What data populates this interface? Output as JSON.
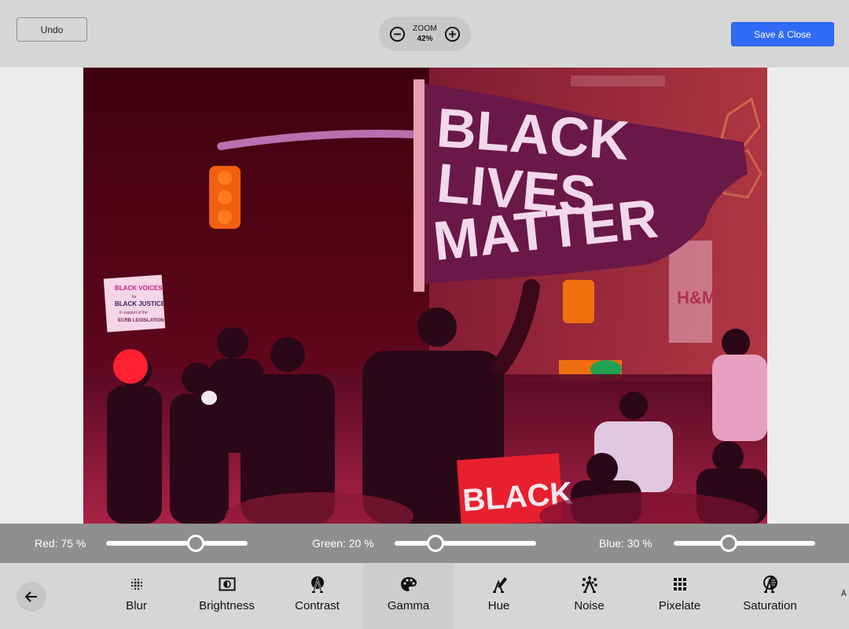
{
  "header": {
    "undo_label": "Undo",
    "zoom": {
      "label": "ZOOM",
      "value": "42%",
      "zoom_out_icon": "minus-circle-icon",
      "zoom_in_icon": "plus-circle-icon"
    },
    "save_label": "Save & Close",
    "save_color": "#2f6bf5"
  },
  "image": {
    "description": "Protest photo with red color filter: man holding 'Black Lives Matter' flag, speaker with microphone, crowd",
    "flag_text": [
      "BLACK",
      "LIVES",
      "MATTER"
    ],
    "sign_text": [
      "BLACK VOICES",
      "for",
      "BLACK JUSTICE",
      "in support of the",
      "ECRB LEGISLATION"
    ],
    "podium_text": "BLACK",
    "store_sign": "H&M"
  },
  "sliders": [
    {
      "name": "red",
      "label": "Red: 75 %",
      "value_percent": 75
    },
    {
      "name": "green",
      "label": "Green: 20 %",
      "value_percent": 20
    },
    {
      "name": "blue",
      "label": "Blue: 30 %",
      "value_percent": 30
    }
  ],
  "toolbar": {
    "back_icon": "arrow-left-icon",
    "tools": [
      {
        "label": "Blur",
        "icon": "blur-dots-icon",
        "active": false
      },
      {
        "label": "Brightness",
        "icon": "brightness-icon",
        "active": false
      },
      {
        "label": "Contrast",
        "icon": "contrast-icon",
        "active": false
      },
      {
        "label": "Gamma",
        "icon": "palette-icon",
        "active": true
      },
      {
        "label": "Hue",
        "icon": "hue-icon",
        "active": false
      },
      {
        "label": "Noise",
        "icon": "noise-icon",
        "active": false
      },
      {
        "label": "Pixelate",
        "icon": "pixelate-grid-icon",
        "active": false
      },
      {
        "label": "Saturation",
        "icon": "saturation-icon",
        "active": false
      }
    ],
    "overflow_glyph": "Ä"
  }
}
